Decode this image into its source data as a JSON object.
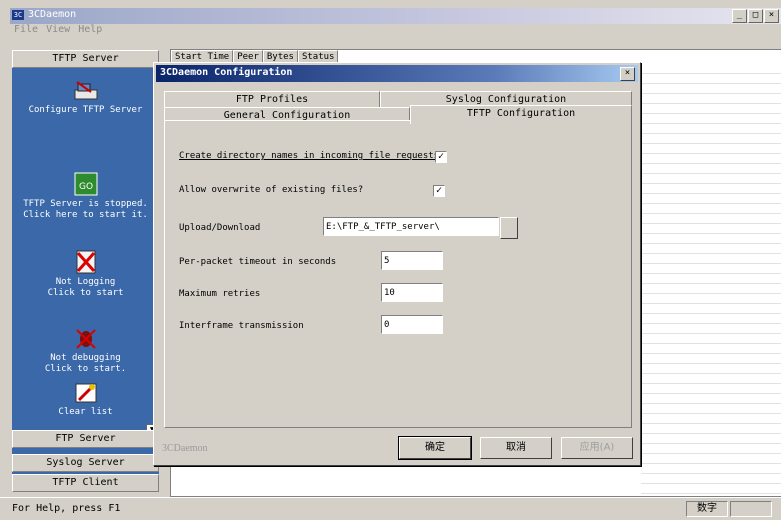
{
  "app": {
    "title": "3CDaemon",
    "menu": [
      "File",
      "View",
      "Help"
    ],
    "window_controls": [
      "_",
      "□",
      "×"
    ]
  },
  "sidebar": {
    "header": "TFTP Server",
    "items": [
      {
        "label": "Configure TFTP Server",
        "icon": "configure-icon"
      },
      {
        "label": "TFTP Server is stopped.\nClick here to start it.",
        "icon": "go-icon"
      },
      {
        "label": "Not Logging\nClick to start",
        "icon": "logging-icon"
      },
      {
        "label": "Not debugging\nClick to start.",
        "icon": "debug-icon"
      },
      {
        "label": "Clear list",
        "icon": "clear-list-icon"
      }
    ],
    "bottom_buttons": [
      "FTP Server",
      "Syslog Server",
      "TFTP Client"
    ]
  },
  "main": {
    "columns": [
      "Start Time",
      "Peer",
      "Bytes",
      "Status"
    ]
  },
  "statusbar": {
    "text": "For Help, press F1",
    "indicator": "数字"
  },
  "dialog": {
    "title": "3CDaemon Configuration",
    "tabs_back": [
      "FTP Profiles",
      "Syslog Configuration"
    ],
    "tabs_front": [
      "General Configuration",
      "TFTP Configuration"
    ],
    "active_tab": "TFTP Configuration",
    "fields": {
      "create_dirs_label": "Create directory names in incoming file requests?",
      "create_dirs_checked": true,
      "allow_overwrite_label": "Allow overwrite of existing files?",
      "allow_overwrite_checked": true,
      "upload_label": "Upload/Download",
      "upload_value": "E:\\FTP_&_TFTP_server\\",
      "timeout_label": "Per-packet timeout in seconds",
      "timeout_value": "5",
      "retries_label": "Maximum retries",
      "retries_value": "10",
      "interframe_label": "Interframe transmission",
      "interframe_value": "0"
    },
    "footer_text": "3CDaemon",
    "buttons": {
      "ok": "确定",
      "cancel": "取消",
      "apply": "应用(A)"
    },
    "check_glyph": "✓"
  }
}
